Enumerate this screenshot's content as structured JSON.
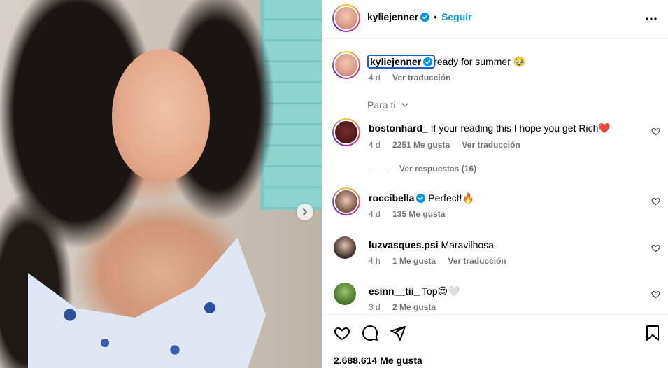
{
  "post": {
    "author": "kyliejenner",
    "follow_label": "Seguir",
    "separator": "•",
    "caption": {
      "username": "kyliejenner",
      "text": "ready for summer 🥹",
      "time": "4 d",
      "translate": "Ver traducción"
    },
    "likes": "2.688.614 Me gusta"
  },
  "filter_label": "Para ti",
  "comments": [
    {
      "username": "bostonhard_",
      "verified": false,
      "text": "If your reading this I hope you get Rich❤️",
      "time": "4 d",
      "likes": "2251 Me gusta",
      "translate": "Ver traducción"
    },
    {
      "username": "roccibella",
      "verified": true,
      "text": "Perfect!🔥",
      "time": "4 d",
      "likes": "135 Me gusta",
      "translate": ""
    },
    {
      "username": "luzvasques.psi",
      "verified": false,
      "text": "Maravilhosa",
      "time": "4 h",
      "likes": "1 Me gusta",
      "translate": "Ver traducción"
    },
    {
      "username": "esinn__tii_",
      "verified": false,
      "text": "Top😍🤍",
      "time": "3 d",
      "likes": "2 Me gusta",
      "translate": ""
    }
  ],
  "replies_label": "Ver respuestas (16)",
  "icons": [
    "verified-badge-icon",
    "more-options-icon",
    "chevron-down-icon",
    "heart-icon",
    "comment-icon",
    "share-icon",
    "bookmark-icon",
    "chevron-right-icon"
  ],
  "colors": {
    "accent": "#0095f6",
    "muted": "#737373",
    "border": "#efefef"
  }
}
